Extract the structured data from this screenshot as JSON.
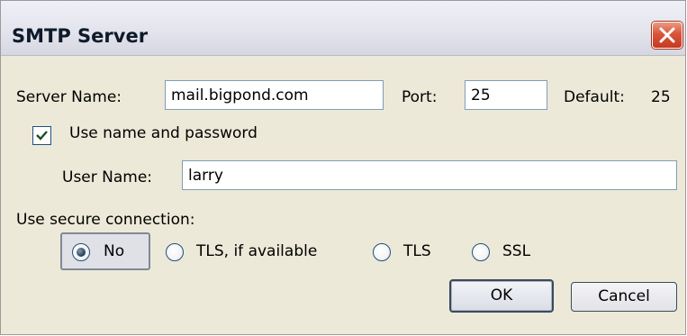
{
  "dialog": {
    "title": "SMTP Server"
  },
  "server": {
    "name_label": "Server Name:",
    "name_value": "mail.bigpond.com",
    "port_label": "Port:",
    "port_value": "25",
    "default_label": "Default:",
    "default_value": "25"
  },
  "auth": {
    "checkbox_label": "Use name and password",
    "checked": true,
    "username_label": "User Name:",
    "username_value": "larry"
  },
  "security": {
    "label": "Use secure connection:",
    "options": [
      "No",
      "TLS, if available",
      "TLS",
      "SSL"
    ],
    "selected": "No"
  },
  "buttons": {
    "ok": "OK",
    "cancel": "Cancel"
  },
  "icons": {
    "close": "close-icon",
    "check": "check-icon"
  },
  "colors": {
    "close_button": "#d9553a",
    "field_border": "#7f9db9",
    "dialog_bg": "#ece9d8"
  }
}
